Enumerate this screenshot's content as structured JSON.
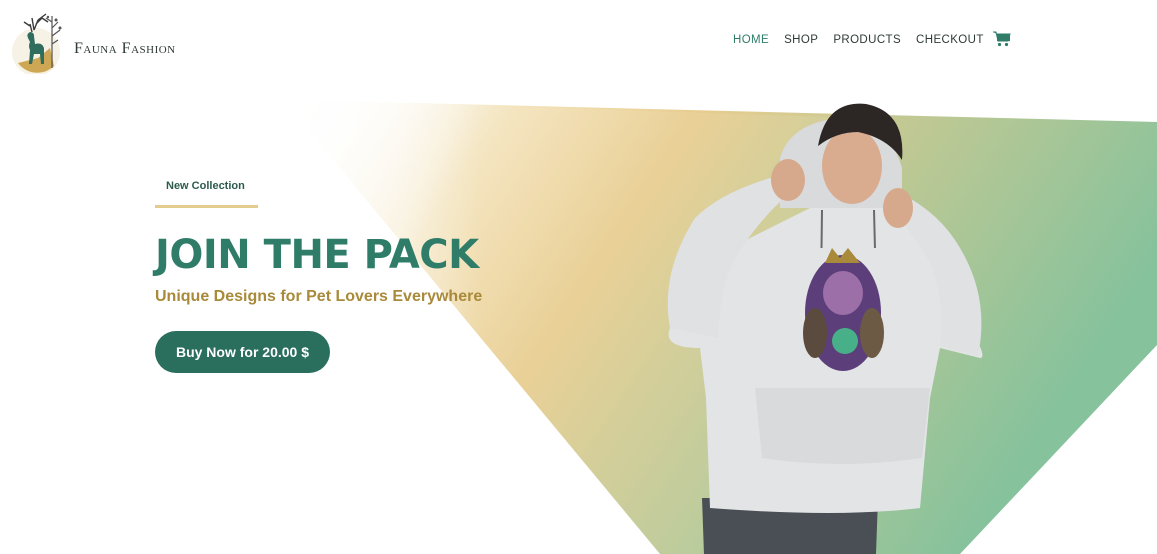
{
  "brand": {
    "name": "Fauna Fashion"
  },
  "nav": {
    "items": [
      {
        "label": "HOME",
        "active": true
      },
      {
        "label": "SHOP",
        "active": false
      },
      {
        "label": "PRODUCTS",
        "active": false
      },
      {
        "label": "CHECKOUT",
        "active": false
      }
    ],
    "cart_icon": "cart-icon"
  },
  "hero": {
    "eyebrow": "New Collection",
    "title": "JOIN THE PACK",
    "subtitle": "Unique Designs for Pet Lovers Everywhere",
    "cta_label": "Buy Now for 20.00 $"
  },
  "colors": {
    "accent_green": "#2f7c69",
    "button_green": "#2a6e5d",
    "gold": "#a88a3a",
    "wedge_gold": "#e8cd8f",
    "wedge_green": "#86c29c"
  }
}
